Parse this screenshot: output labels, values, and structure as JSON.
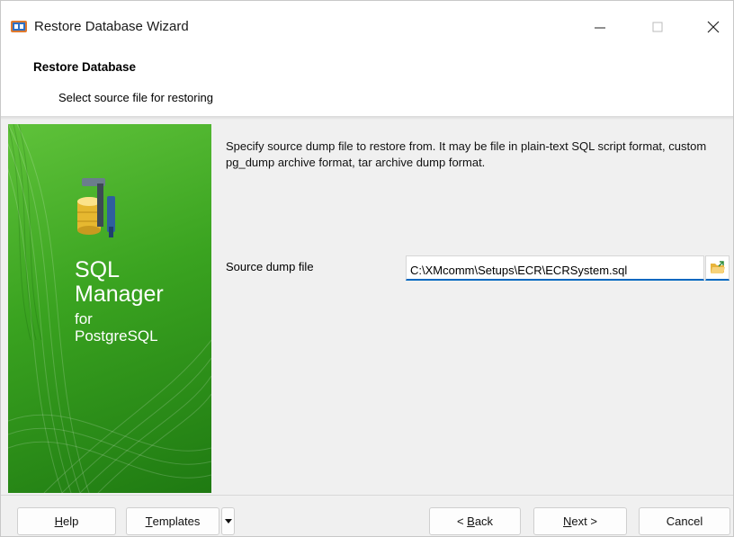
{
  "window": {
    "title": "Restore Database Wizard",
    "controls": {
      "minimize": "—",
      "maximize": "☐",
      "close": "✕"
    }
  },
  "header": {
    "title": "Restore Database",
    "subtitle": "Select source file for restoring"
  },
  "banner": {
    "brand_line1": "SQL",
    "brand_line2": "Manager",
    "brand_line3": "for",
    "brand_line4": "PostgreSQL",
    "icon": "database-tools-icon",
    "colors": {
      "green_light": "#5fc23a",
      "green_dark": "#1f7a12"
    }
  },
  "content": {
    "description": "Specify source dump file to restore from. It may be file in plain-text SQL script format, custom pg_dump archive format, tar archive dump format.",
    "source_label": "Source dump file",
    "source_value": "C:\\XMcomm\\Setups\\ECR\\ECRSystem.sql",
    "browse_icon": "folder-open-icon"
  },
  "footer": {
    "help_first": "H",
    "help_rest": "elp",
    "templates_first": "T",
    "templates_rest": "emplates",
    "back_prefix": "< ",
    "back_first": "B",
    "back_rest": "ack",
    "next_first": "N",
    "next_rest": "ext >",
    "cancel": "Cancel"
  },
  "colors": {
    "accent": "#0067c0",
    "background": "#f0f0f0"
  }
}
